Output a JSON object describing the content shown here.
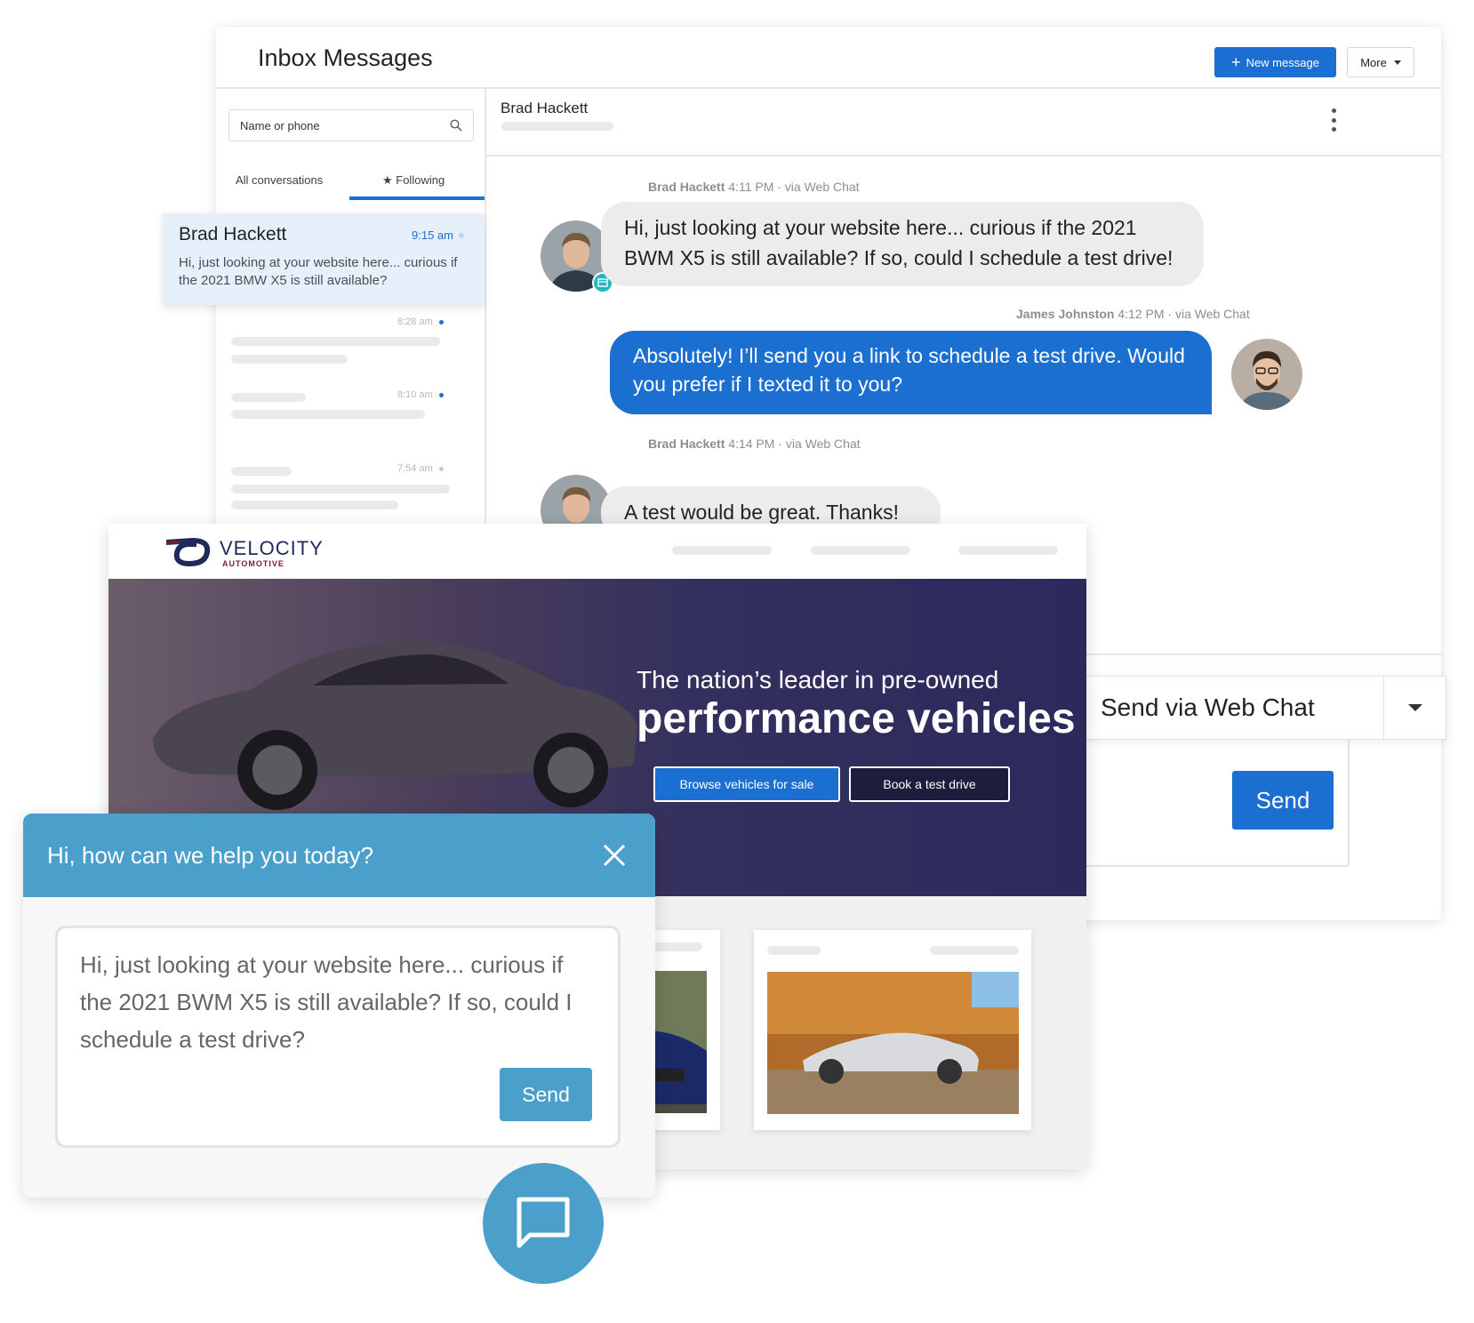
{
  "inbox": {
    "title": "Inbox Messages",
    "new_message_label": "New message",
    "more_label": "More",
    "search_placeholder": "Name or phone",
    "tabs": [
      {
        "label": "All conversations"
      },
      {
        "label": "★ Following"
      }
    ],
    "selected_conversation": {
      "name": "Brad Hackett",
      "time": "9:15 am",
      "preview": "Hi, just looking at your website here... curious if the 2021 BMW X5 is still available?"
    },
    "other_conversation_times": [
      "8:28 am",
      "8:10 am",
      "7:54 am"
    ]
  },
  "chat": {
    "contact_name": "Brad Hackett",
    "messages": [
      {
        "sender": "Brad Hackett",
        "meta": "4:11 PM · via Web Chat",
        "text": "Hi, just looking at your website here... curious if the 2021 BWM X5 is still available?  If so, could I schedule a test drive!"
      },
      {
        "sender": "James Johnston",
        "meta": "4:12 PM · via Web Chat",
        "text": "Absolutely!  I’ll send you a link to schedule a test drive. Would you prefer if I texted it to you?"
      },
      {
        "sender": "Brad Hackett",
        "meta": "4:14 PM · via Web Chat",
        "text": "A test would be great.  Thanks!"
      }
    ],
    "send_channel_label": "Send via Web Chat",
    "send_label": "Send"
  },
  "website": {
    "brand": "VELOCITY",
    "brand_sub": "AUTOMOTIVE",
    "hero_sub": "The nation’s leader in pre-owned",
    "hero_title": "performance vehicles",
    "browse_label": "Browse vehicles for sale",
    "book_label": "Book a test drive"
  },
  "widget": {
    "title": "Hi, how can we help you today?",
    "message": "Hi, just looking at your website here... curious if the 2021 BWM X5 is still available? If so, could I schedule a test drive?",
    "send_label": "Send"
  },
  "colors": {
    "primary": "#1b6fd1",
    "widget": "#4a9fcb",
    "hero_dark": "#2c2a5c"
  },
  "icons": [
    "plus-icon",
    "caret-down-icon",
    "search-icon",
    "star-icon",
    "kebab-icon",
    "webchat-badge-icon",
    "close-icon",
    "chat-bubble-icon"
  ]
}
